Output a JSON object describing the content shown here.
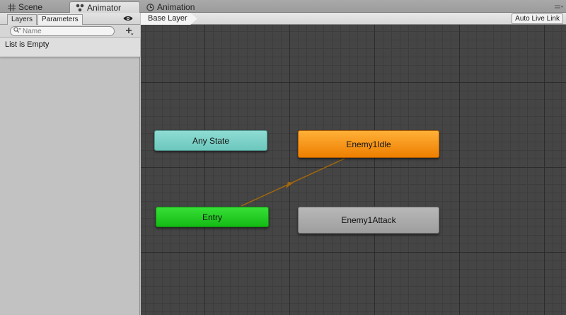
{
  "window_tabs": [
    {
      "label": "Scene",
      "icon": "grid-icon"
    },
    {
      "label": "Animator",
      "icon": "animator-icon"
    },
    {
      "label": "Animation",
      "icon": "clock-icon"
    }
  ],
  "left_panel": {
    "tabs": {
      "layers": "Layers",
      "parameters": "Parameters"
    },
    "active_tab": "Parameters",
    "search": {
      "placeholder": "Name",
      "value": ""
    },
    "empty_message": "List is Empty"
  },
  "graph": {
    "breadcrumb": "Base Layer",
    "auto_live_link": "Auto Live Link",
    "states": {
      "any_state": "Any State",
      "idle": "Enemy1Idle",
      "entry": "Entry",
      "attack": "Enemy1Attack"
    },
    "colors": {
      "any_state": "#6cc7bd",
      "default_state": "#ee7f00",
      "entry": "#14bb14",
      "state": "#9e9e9e",
      "transition": "#a3670c"
    }
  }
}
